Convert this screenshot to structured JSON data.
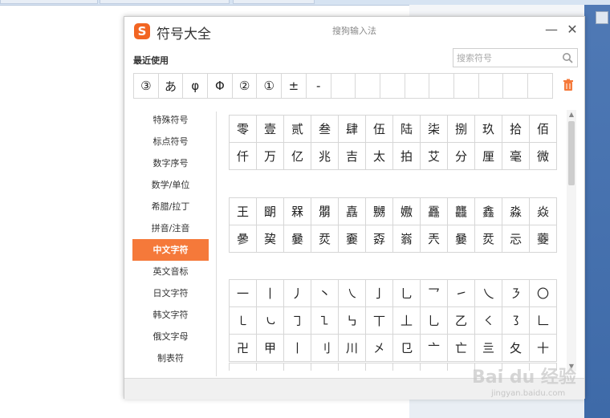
{
  "window": {
    "title": "符号大全",
    "subtitle": "搜狗输入法",
    "logo_text": "S",
    "minimize": "—",
    "close": "✕"
  },
  "recent": {
    "label": "最近使用",
    "symbols": [
      "③",
      "あ",
      "φ",
      "Φ",
      "②",
      "①",
      "±",
      "-",
      "",
      "",
      "",
      "",
      "",
      "",
      "",
      "",
      ""
    ]
  },
  "search": {
    "placeholder": "搜索符号",
    "value": ""
  },
  "sidebar": {
    "items": [
      {
        "label": "特殊符号"
      },
      {
        "label": "标点符号"
      },
      {
        "label": "数字序号"
      },
      {
        "label": "数学/单位"
      },
      {
        "label": "希腊/拉丁"
      },
      {
        "label": "拼音/注音"
      },
      {
        "label": "中文字符"
      },
      {
        "label": "英文音标"
      },
      {
        "label": "日文字符"
      },
      {
        "label": "韩文字符"
      },
      {
        "label": "俄文字母"
      },
      {
        "label": "制表符"
      }
    ],
    "active_index": 6
  },
  "grid1": [
    "零",
    "壹",
    "贰",
    "叁",
    "肆",
    "伍",
    "陆",
    "柒",
    "捌",
    "玖",
    "拾",
    "佰",
    "仟",
    "万",
    "亿",
    "兆",
    "吉",
    "太",
    "拍",
    "艾",
    "分",
    "厘",
    "毫",
    "微"
  ],
  "grid2": [
    "王",
    "朙",
    "槑",
    "朤",
    "嚞",
    "嬲",
    "嫐",
    "靐",
    "龘",
    "鑫",
    "淼",
    "焱",
    "曑",
    "巭",
    "嘦",
    "烎",
    "嫑",
    "孬",
    "嵡",
    "兲",
    "嘦",
    "烎",
    "忈",
    "虁"
  ],
  "grid3": [
    "一",
    "丨",
    "丿",
    "丶",
    "㇏",
    "亅",
    "乚",
    "乛",
    "㇀",
    "乀",
    "㇋",
    "〇",
    "㇄",
    "㇃",
    "㇆",
    "㇅",
    "㇉",
    "丅",
    "丄",
    "乚",
    "乙",
    "㇛",
    "㇌",
    "𠃊",
    "卍",
    "甲",
    "丨",
    "刂",
    "川",
    "㐅",
    "㔾",
    "亠",
    "亡",
    "亖",
    "夂",
    "十"
  ],
  "colors": {
    "accent": "#f5793a",
    "logo": "#f26522"
  },
  "watermark": {
    "brand": "Bai du 经验",
    "url": "jingyan.baidu.com"
  }
}
